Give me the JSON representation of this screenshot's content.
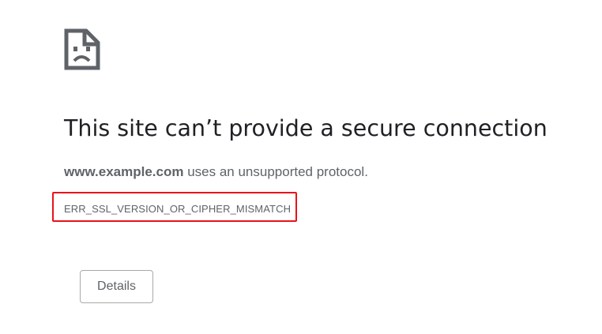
{
  "error_page": {
    "icon": "sad-document-icon",
    "title": "This site can’t provide a secure connection",
    "summary": {
      "domain": "www.example.com",
      "message": " uses an unsupported protocol."
    },
    "error_code": "ERR_SSL_VERSION_OR_CIPHER_MISMATCH",
    "details_button_label": "Details"
  },
  "colors": {
    "title": "#202124",
    "body_text": "#5f6368",
    "highlight_box": "#e8121b",
    "button_border": "#a9a9a9"
  }
}
